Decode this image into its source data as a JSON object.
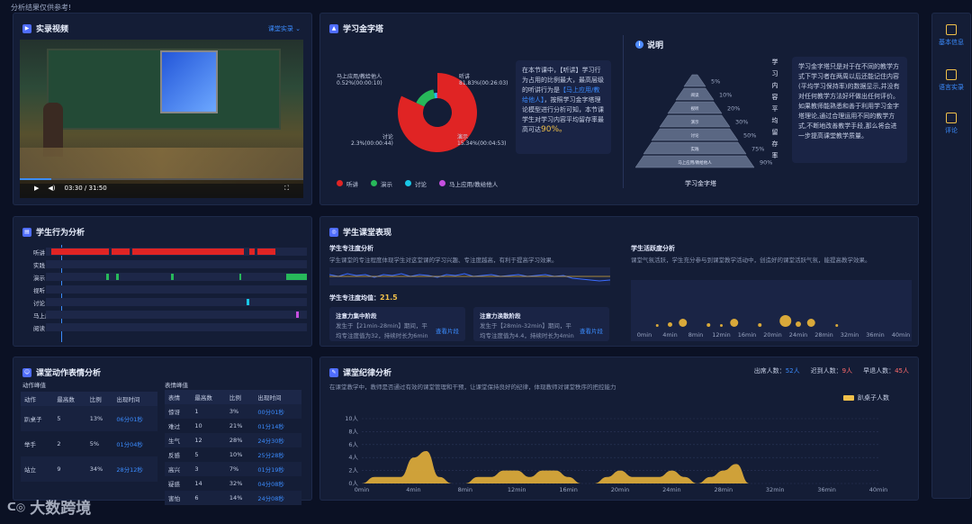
{
  "top_note": "分析结果仅供参考!",
  "video_panel": {
    "title": "实录视频",
    "selector": "课堂实录",
    "time": "03:30 / 31:50",
    "progress": 0.11
  },
  "pyramid_panel": {
    "title": "学习金字塔",
    "donut_labels": {
      "l1": "马上应用/教给他人",
      "l1v": "0.52%(00:00:10)",
      "l2": "听讲",
      "l2v": "81.83%(00:26:03)",
      "l3": "讨论",
      "l3v": "2.3%(00:00:44)",
      "l4": "演示",
      "l4v": "15.34%(00:04:53)"
    },
    "donut_values": [
      81.83,
      15.34,
      2.3,
      0.52
    ],
    "donut_colors": [
      "#e02424",
      "#27b85a",
      "#19c7e6",
      "#c64fe0"
    ],
    "summary_a": "在本节课中，【听讲】学习行为占用的比例最大，最高层级的听讲行为是",
    "summary_link": "【马上应用/教给他人】",
    "summary_b": "，按照学习金字塔理论模型进行分析可知，本节课学生对学习内容平均留存率最高可达",
    "summary_pct": "90%。",
    "legend": [
      "听讲",
      "演示",
      "讨论",
      "马上应用/教给他人"
    ],
    "explain_title": "说明",
    "levels": [
      "听讲",
      "阅读",
      "视听",
      "演示",
      "讨论",
      "实践",
      "马上应用/教给他人"
    ],
    "level_pct": [
      "5%",
      "10%",
      "20%",
      "30%",
      "50%",
      "75%",
      "90%"
    ],
    "axis_caption": "学习内容平均留存率",
    "pyramid_caption": "学习金字塔",
    "explain_text": "学习金字塔只是对于在不同的教学方式下学习者在两周以后还能记住内容(平均学习保持率)的数据显示,并没有对任何教学方法好坏做出任何评价。如果教师能熟悉和善于利用学习金字塔理论,通过合理运用不同的教学方式,不断地改善教学手段,那么将会进一步提高课堂教学质量。"
  },
  "behavior_panel": {
    "title": "学生行为分析",
    "rows": [
      "听讲",
      "实践",
      "演示",
      "视听",
      "讨论",
      "马上应用/教给他人",
      "阅读"
    ]
  },
  "performance_panel": {
    "title": "学生课堂表现",
    "focus_title": "学生专注度分析",
    "focus_desc": "学生课堂的专注程度体现学生对这堂课的学习兴趣、专注度越高，有利于提高学习效果。",
    "avg_label": "学生专注度均值：",
    "avg_value": "21.5",
    "phase1_title": "注意力集中阶段",
    "phase1_text": "发生于【21min-28min】期间，平均专注度值为32，持续时长为6min",
    "phase2_title": "注意力涣散阶段",
    "phase2_text": "发生于【28min-32min】期间，平均专注度值为4.4，持续时长为4min",
    "link": "查看片段",
    "active_title": "学生活跃度分析",
    "active_desc": "课堂气氛活跃，学生充分参与到课堂教学活动中，创造好的课堂活跃气氛，能提高教学效果。",
    "active_ticks": [
      "0min",
      "4min",
      "8min",
      "12min",
      "16min",
      "20min",
      "24min",
      "28min",
      "32min",
      "36min",
      "40min"
    ]
  },
  "emotion_panel": {
    "title": "课堂动作表情分析",
    "action_label": "动作峰值",
    "action_headers": [
      "动作",
      "最高数",
      "比例",
      "出现时间"
    ],
    "action_rows": [
      [
        "趴桌子",
        "5",
        "13%",
        "06分01秒"
      ],
      [
        "举手",
        "2",
        "5%",
        "01分04秒"
      ],
      [
        "站立",
        "9",
        "34%",
        "28分12秒"
      ]
    ],
    "emotion_label": "表情峰值",
    "emotion_headers": [
      "表情",
      "最高数",
      "比例",
      "出现时间"
    ],
    "emotion_rows": [
      [
        "惊讶",
        "1",
        "3%",
        "00分01秒"
      ],
      [
        "难过",
        "10",
        "21%",
        "01分14秒"
      ],
      [
        "生气",
        "12",
        "28%",
        "24分30秒"
      ],
      [
        "反感",
        "5",
        "10%",
        "25分28秒"
      ],
      [
        "高兴",
        "3",
        "7%",
        "01分19秒"
      ],
      [
        "疑惑",
        "14",
        "32%",
        "04分08秒"
      ],
      [
        "害怕",
        "6",
        "14%",
        "24分08秒"
      ]
    ]
  },
  "discipline_panel": {
    "title": "课堂纪律分析",
    "desc": "在课堂教学中，教师是否通过有效的课堂管理和干预，让课堂保持良好的纪律，体现教师对课堂秩序的把控能力",
    "attendance_label": "出席人数：",
    "attendance": "52人",
    "late_label": "迟到人数：",
    "late": "9人",
    "early_label": "早退人数：",
    "early": "45人",
    "legend": "趴桌子人数"
  },
  "sidebar": [
    "基本信息",
    "语言实录",
    "评论"
  ],
  "watermark": "大数跨境",
  "chart_data": {
    "type": "area",
    "title": "",
    "series": [
      {
        "name": "趴桌子人数",
        "values": [
          0,
          1,
          1,
          1,
          4,
          5,
          1,
          0,
          0,
          1,
          1,
          2,
          2,
          1,
          2,
          2,
          1,
          0,
          0,
          1,
          2,
          1,
          1,
          1,
          2,
          1,
          0,
          1,
          2,
          3,
          0,
          0,
          0,
          0,
          0,
          0,
          0,
          0,
          0,
          0,
          0
        ],
        "x": [
          0,
          1,
          2,
          3,
          4,
          5,
          6,
          7,
          8,
          9,
          10,
          11,
          12,
          13,
          14,
          15,
          16,
          17,
          18,
          19,
          20,
          21,
          22,
          23,
          24,
          25,
          26,
          27,
          28,
          29,
          30,
          31,
          32,
          33,
          34,
          35,
          36,
          37,
          38,
          39,
          40
        ]
      }
    ],
    "x_ticks": [
      "0min",
      "4min",
      "8min",
      "12min",
      "16min",
      "20min",
      "24min",
      "28min",
      "32min",
      "36min",
      "40min"
    ],
    "y_ticks": [
      "0人",
      "2人",
      "4人",
      "6人",
      "8人",
      "10人"
    ],
    "ylim": [
      0,
      10
    ],
    "xlim": [
      0,
      40
    ],
    "color": "#d9a93a"
  }
}
